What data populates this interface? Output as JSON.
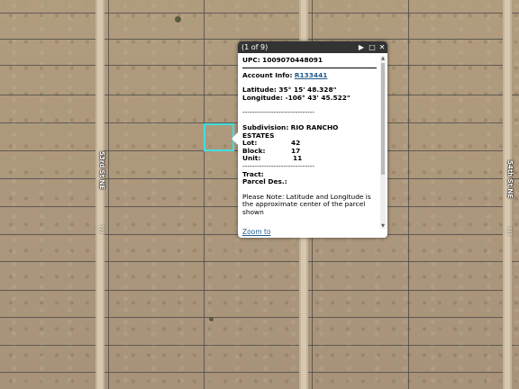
{
  "map": {
    "streets": [
      {
        "label": "53rd St NE"
      },
      {
        "label": "54th St NE"
      }
    ],
    "small_labels": [
      "???",
      "???"
    ]
  },
  "popup": {
    "counter": "(1 of 9)",
    "buttons": {
      "next": "▶",
      "maximize": "□",
      "close": "✕"
    },
    "upc_label": "UPC:",
    "upc_value": "1009070448091",
    "account_label": "Account Info:",
    "account_value": "R133441",
    "latitude": "Latitude: 35° 15' 48.328\"",
    "longitude": "Longitude: -106° 43' 45.522\"",
    "separator": "------------------------------",
    "subdivision_label": "Subdivision:",
    "subdivision_value_1": "RIO RANCHO",
    "subdivision_value_2": "ESTATES",
    "lot_label": "Lot:",
    "lot_value": "42",
    "block_label": "Block:",
    "block_value": "17",
    "unit_label": "Unit:",
    "unit_value": "11",
    "tract_label": "Tract:",
    "parcel_label": "Parcel Des.:",
    "note_1": "Please Note: Latitude and Longitude is",
    "note_2": "the approximate center of the parcel",
    "note_3": "shown",
    "zoom_to": "Zoom to"
  }
}
